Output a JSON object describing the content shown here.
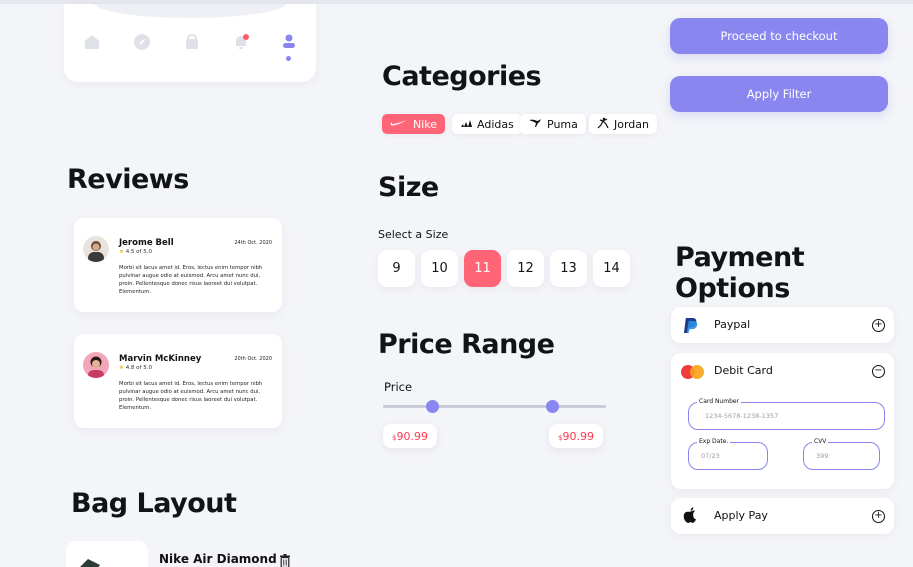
{
  "nav": {
    "icons": [
      "home-icon",
      "compass-icon",
      "bag-icon",
      "bell-icon",
      "user-icon"
    ]
  },
  "reviews": {
    "title": "Reviews",
    "items": [
      {
        "name": "Jerome Bell",
        "date": "24th Oct. 2020",
        "rating": "4.5 of 5.0",
        "text": "Morbi sit lacus amet id. Eros, lectus enim tempor nibh pulvinar augue odio at euismod. Arcu amet nunc dui, proin. Pellentesque donec risus laoreet dui volutpat. Elementum."
      },
      {
        "name": "Marvin McKinney",
        "date": "20th Oct. 2020",
        "rating": "4.8 of 5.0",
        "text": "Morbi sit lacus amet id. Eros, lectus enim tempor nibh pulvinar augue odio at euismod. Arcu amet nunc dui, proin. Pellentesque donec risus laoreet dui volutpat. Elementum."
      }
    ]
  },
  "bag": {
    "title": "Bag Layout",
    "item_name": "Nike Air Diamond"
  },
  "categories": {
    "title": "Categories",
    "items": [
      "Nike",
      "Adidas",
      "Puma",
      "Jordan"
    ],
    "selected": "Nike"
  },
  "size": {
    "title": "Size",
    "subtitle": "Select a Size",
    "options": [
      "9",
      "10",
      "11",
      "12",
      "13",
      "14"
    ],
    "selected": "11"
  },
  "price_range": {
    "title": "Price Range",
    "label": "Price",
    "currency": "$",
    "min_value": "90.99",
    "max_value": "90.99",
    "min_fraction": 0.22,
    "max_fraction": 0.76
  },
  "actions": {
    "checkout_label": "Proceed to checkout",
    "filter_label": "Apply Filter"
  },
  "payment": {
    "title": "Payment Options",
    "paypal": "Paypal",
    "debit": "Debit Card",
    "apple": "Apply Pay",
    "card_number_label": "Card Number",
    "card_number_placeholder": "1234-5678-1238-1357",
    "exp_label": "Exp Date.",
    "exp_placeholder": "07/23",
    "cvv_label": "CVV",
    "cvv_placeholder": "399"
  },
  "colors": {
    "accent": "#8a86f0",
    "highlight": "#ff6577",
    "price": "#ff3850"
  }
}
